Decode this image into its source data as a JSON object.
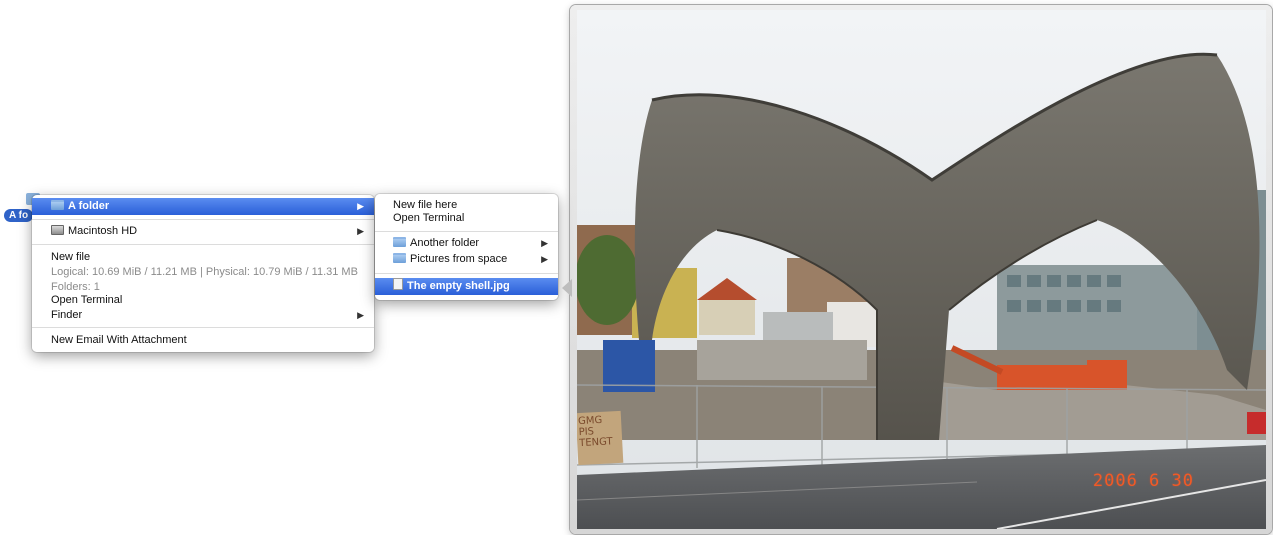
{
  "desktop": {
    "selected_label": "A fo"
  },
  "main_menu": {
    "items": [
      {
        "label": "A folder",
        "icon": "folder-icon",
        "has_submenu": true,
        "selected": true
      },
      {
        "label": "Macintosh HD",
        "icon": "disk-icon",
        "has_submenu": true,
        "selected": false
      }
    ],
    "new_file": "New file",
    "info_sizes": "Logical: 10.69 MiB / 11.21 MB | Physical: 10.79 MiB / 11.31 MB",
    "info_folders": "Folders: 1",
    "open_terminal": "Open Terminal",
    "finder": "Finder",
    "new_email": "New Email With Attachment"
  },
  "submenu": {
    "new_file_here": "New file here",
    "open_terminal": "Open Terminal",
    "folders": [
      {
        "label": "Another folder",
        "icon": "folder-icon"
      },
      {
        "label": "Pictures from space",
        "icon": "folder-icon"
      }
    ],
    "selected_file": "The empty shell.jpg"
  },
  "preview": {
    "date_stamp": "2006  6 30",
    "sign_text": "GMG PIS TENGT"
  },
  "colors": {
    "selection": "#2a5fd8",
    "stamp": "#f25a25"
  }
}
